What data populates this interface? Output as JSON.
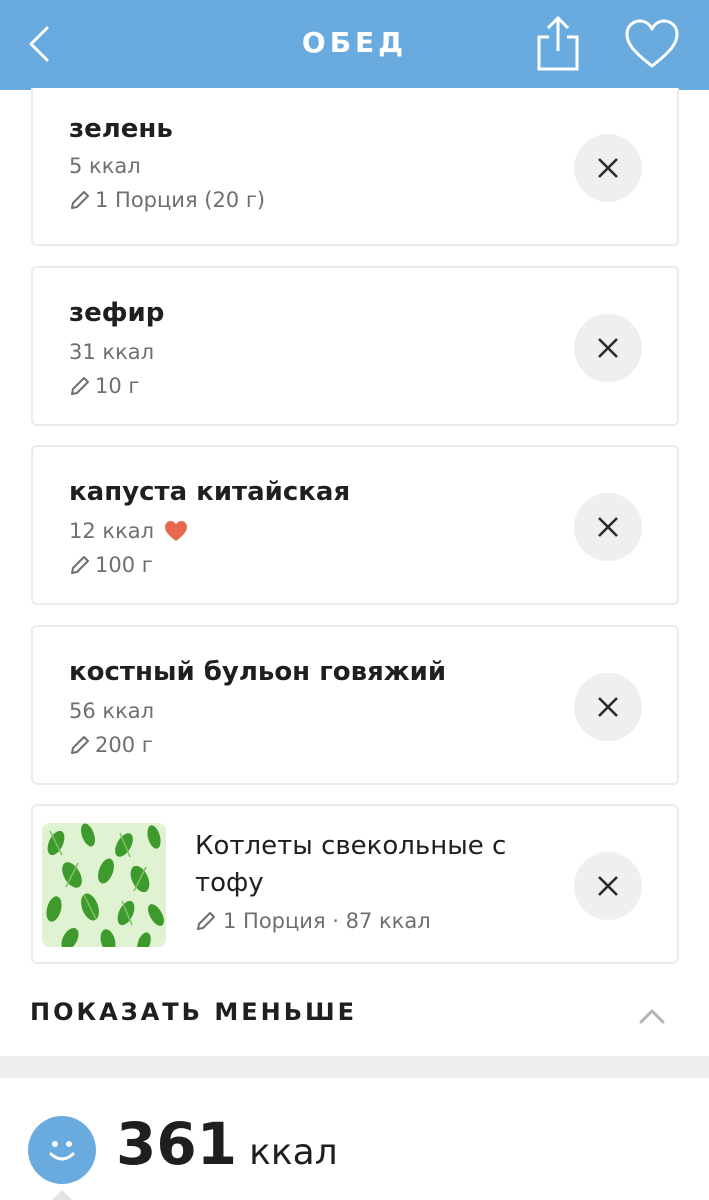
{
  "header": {
    "title": "ОБЕД",
    "back_icon": "chevron-left-icon",
    "share_icon": "share-icon",
    "favorite_icon": "heart-outline-icon",
    "bg_color": "#6aabdf"
  },
  "items": [
    {
      "name": "зелень",
      "kcal": "5 ккал",
      "portion": "1 Порция (20 г)",
      "favorite": false
    },
    {
      "name": "зефир",
      "kcal": "31 ккал",
      "portion": "10 г",
      "favorite": false
    },
    {
      "name": "капуста китайская",
      "kcal": "12 ккал",
      "portion": "100 г",
      "favorite": true
    },
    {
      "name": "костный бульон говяжий",
      "kcal": "56 ккал",
      "portion": "200 г",
      "favorite": false
    }
  ],
  "recipe": {
    "name": "Котлеты свекольные с тофу",
    "portion": "1 Порция · 87 ккал"
  },
  "toggle": {
    "label": "ПОКАЗАТЬ МЕНЬШЕ"
  },
  "summary": {
    "total": "361",
    "unit": "ккал"
  },
  "colors": {
    "accent": "#6aabdf",
    "favorite": "#e8684f",
    "remove_bg": "#efefef"
  }
}
